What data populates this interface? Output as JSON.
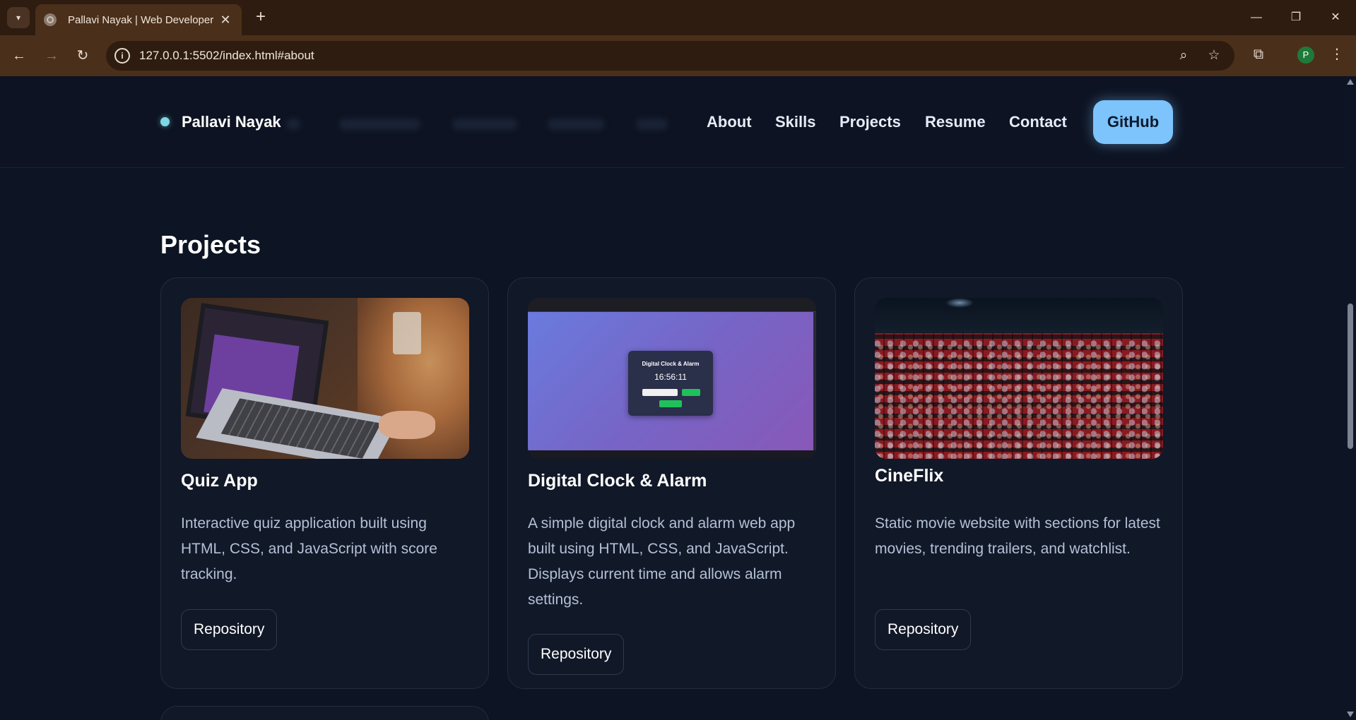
{
  "browser": {
    "tab_title": "Pallavi Nayak | Web Developer",
    "url": "127.0.0.1:5502/index.html#about",
    "profile_initial": "P"
  },
  "site": {
    "brand": "Pallavi Nayak",
    "nav": [
      "About",
      "Skills",
      "Projects",
      "Resume",
      "Contact"
    ],
    "github_label": "GitHub",
    "accent": "#7cc4fb"
  },
  "projects": {
    "heading": "Projects",
    "cards": [
      {
        "title": "Quiz App",
        "description": "Interactive quiz application built using HTML, CSS, and JavaScript with score tracking.",
        "button": "Repository"
      },
      {
        "title": "Digital Clock & Alarm",
        "description": "A simple digital clock and alarm web app built using HTML, CSS, and JavaScript. Displays current time and allows alarm settings.",
        "button": "Repository",
        "screenshot_heading": "Digital Clock & Alarm",
        "screenshot_time": "16:56:11"
      },
      {
        "title": "CineFlix",
        "description": "Static movie website with sections for latest movies, trending trailers, and watchlist.",
        "button": "Repository"
      }
    ]
  }
}
